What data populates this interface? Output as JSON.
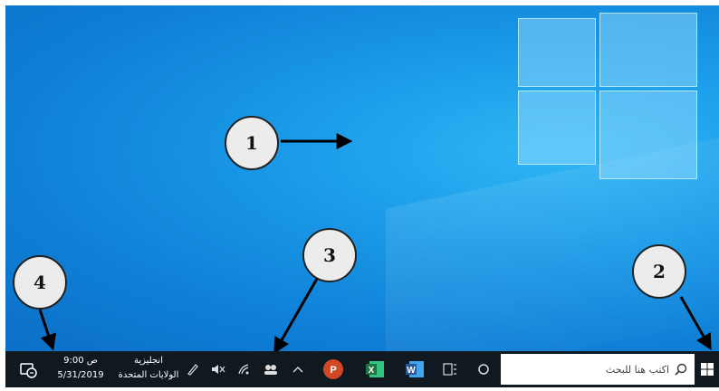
{
  "desktop": {
    "callouts": [
      "1",
      "2",
      "3",
      "4"
    ]
  },
  "taskbar": {
    "search_placeholder": "اكتب هنا للبحث",
    "clock": {
      "time": "9:00 ص",
      "date": "5/31/2019"
    },
    "language": {
      "line1": "انجليزية",
      "line2": "الولايات المتحدة"
    },
    "apps": [
      "word-icon",
      "excel-icon",
      "powerpoint-icon"
    ],
    "tray_icons": [
      "chevron-up-icon",
      "people-icon",
      "network-icon",
      "volume-mute-icon",
      "pen-icon"
    ]
  },
  "colors": {
    "taskbar": "#101820",
    "desktop": "#1a9ae8",
    "word": "#2b579a",
    "excel": "#217346",
    "powerpoint": "#d24726"
  }
}
